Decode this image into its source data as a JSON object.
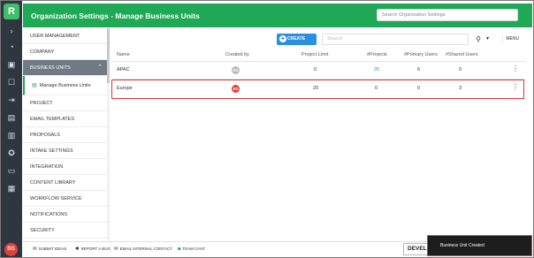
{
  "rail": {
    "logo": "R",
    "collapse_icon": "›",
    "avatar_initials": "SG"
  },
  "header": {
    "title": "Organization Settings - Manage Business Units",
    "search_placeholder": "Search Organization Settings",
    "bg_color": "#1fa855"
  },
  "sidebar": {
    "items": [
      {
        "label": "User Management"
      },
      {
        "label": "Company"
      },
      {
        "label": "Business Units",
        "active": true
      },
      {
        "label": "Project"
      },
      {
        "label": "Email Templates"
      },
      {
        "label": "Proposals"
      },
      {
        "label": "Intake Settings"
      },
      {
        "label": "Integration"
      },
      {
        "label": "Content Library"
      },
      {
        "label": "Workflow Service"
      },
      {
        "label": "Notifications"
      },
      {
        "label": "Security"
      }
    ],
    "sub_item": "Manage Business Units"
  },
  "toolbar": {
    "create_label": "CREATE NEW",
    "search_placeholder": "Search",
    "menu_label": "MENU"
  },
  "table": {
    "columns": [
      "Name",
      "Created by",
      "Project Limit",
      "#Projects",
      "#Primary Users",
      "#Shared Users"
    ],
    "rows": [
      {
        "name": "APAC",
        "creator": "SG",
        "project_limit": "0",
        "projects": "26",
        "primary_users": "6",
        "shared_users": "0"
      },
      {
        "name": "Europe",
        "creator": "SG",
        "project_limit": "20",
        "projects": "0",
        "primary_users": "0",
        "shared_users": "3"
      }
    ]
  },
  "bottom": {
    "links": [
      "SUBMIT IDEAS",
      "REPORT A BUG",
      "EMAIL INTERNAL CONTACT",
      "TEAM CHAT"
    ],
    "dev_button": "DEVELO"
  },
  "toast": {
    "message": "Business Unit Created"
  },
  "colors": {
    "accent": "#2a8fe0",
    "brand": "#1fa855",
    "highlight": "#d23a3a"
  }
}
